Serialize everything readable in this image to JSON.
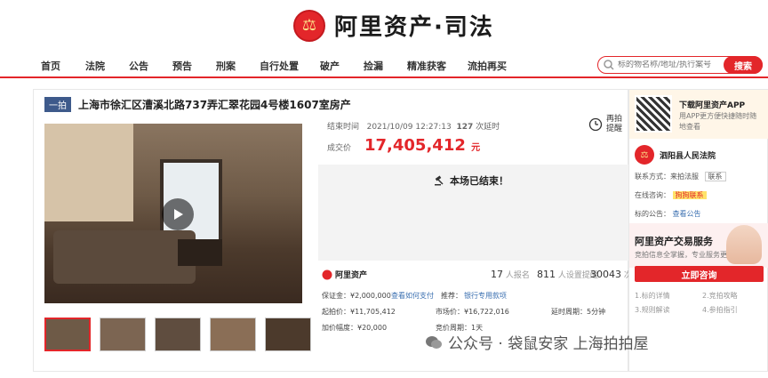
{
  "header": {
    "logo_text": "阿里资产·司法",
    "emblem_icon": "court-emblem-icon"
  },
  "nav": {
    "items": [
      "首页",
      "法院",
      "公告",
      "预告",
      "刑案",
      "自行处置",
      "破产",
      "捡漏",
      "精准获客",
      "流拍再买"
    ]
  },
  "search": {
    "placeholder": "标的物名称/地址/执行案号",
    "button": "搜索"
  },
  "lot": {
    "badge": "一拍",
    "title": "上海市徐汇区漕溪北路737弄汇翠花园4号楼1607室房产"
  },
  "status": {
    "end_label": "结束时间",
    "end_time": "2021/10/09 12:27:13",
    "bids": "127",
    "bids_label": "次延时",
    "remind": "再拍提醒"
  },
  "deal": {
    "label": "成交价",
    "price": "17,405,412",
    "unit": "元"
  },
  "ended": {
    "text": "本场已结束！"
  },
  "stats": {
    "brand": "阿里资产",
    "enrolled": "17",
    "enrolled_label": "人报名",
    "remind": "811",
    "remind_label": "人设置提醒",
    "views": "30043",
    "views_label": "次围观"
  },
  "rows": {
    "deposit": "保证金：¥2,000,000",
    "deposit_link": "查看如何支付",
    "recommend": "推荐：",
    "recommend_link": "银行专用款项",
    "start": "起拍价：¥11,705,412",
    "market": "市场价：¥16,722,016",
    "delay": "延时周期：5分钟",
    "step": "加价幅度：¥20,000",
    "cycle": "竞价周期：1天"
  },
  "side": {
    "app_title": "下载阿里资产APP",
    "app_sub": "用APP更方便快捷随时随地查看",
    "court": "泗阳县人民法院",
    "contact_label": "联系方式：",
    "contact_value": "来拍法服",
    "contact_btn": "联系",
    "online_label": "在线咨询：",
    "online_btn": "狗狗联系",
    "notice_label": "标的公告：",
    "notice_link": "查看公告",
    "service_title": "阿里资产交易服务",
    "service_sub": "竞拍信息全掌握，专业服务更放心",
    "consult": "立即咨询",
    "guide": [
      "1.标的详情",
      "2.竞拍攻略",
      "3.规则解读",
      "4.参拍指引"
    ]
  },
  "watermark": "公众号 · 袋鼠安家 上海拍拍屋",
  "colors": {
    "accent": "#e3262a",
    "badge": "#3e5a8b",
    "link": "#3a6fb0"
  }
}
